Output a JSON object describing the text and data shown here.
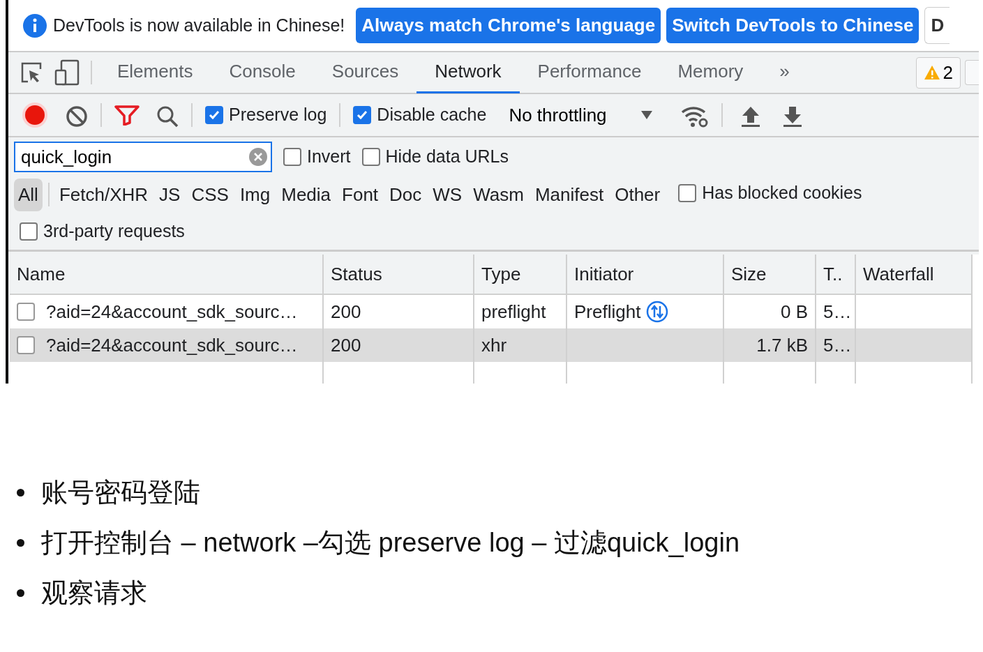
{
  "infobar": {
    "message": "DevTools is now available in Chinese!",
    "buttons": [
      "Always match Chrome's language",
      "Switch DevTools to Chinese",
      "D"
    ]
  },
  "panel_tabs": [
    {
      "label": "Elements",
      "selected": false
    },
    {
      "label": "Console",
      "selected": false
    },
    {
      "label": "Sources",
      "selected": false
    },
    {
      "label": "Network",
      "selected": true
    },
    {
      "label": "Performance",
      "selected": false
    },
    {
      "label": "Memory",
      "selected": false
    }
  ],
  "more_tabs": "»",
  "warnings": "2",
  "toolbar": {
    "recording": true,
    "preserve_log": {
      "label": "Preserve log",
      "checked": true
    },
    "disable_cache": {
      "label": "Disable cache",
      "checked": true
    },
    "throttling": "No throttling"
  },
  "filter": {
    "value": "quick_login",
    "invert": {
      "label": "Invert",
      "checked": false
    },
    "hide_data_urls": {
      "label": "Hide data URLs",
      "checked": false
    }
  },
  "type_filters": [
    {
      "label": "All",
      "selected": true
    },
    {
      "label": "Fetch/XHR",
      "selected": false
    },
    {
      "label": "JS",
      "selected": false
    },
    {
      "label": "CSS",
      "selected": false
    },
    {
      "label": "Img",
      "selected": false
    },
    {
      "label": "Media",
      "selected": false
    },
    {
      "label": "Font",
      "selected": false
    },
    {
      "label": "Doc",
      "selected": false
    },
    {
      "label": "WS",
      "selected": false
    },
    {
      "label": "Wasm",
      "selected": false
    },
    {
      "label": "Manifest",
      "selected": false
    },
    {
      "label": "Other",
      "selected": false
    }
  ],
  "has_blocked_cookies": {
    "label": "Has blocked cookies",
    "checked": false
  },
  "third_party": {
    "label": "3rd-party requests",
    "checked": false
  },
  "table": {
    "columns": [
      "Name",
      "Status",
      "Type",
      "Initiator",
      "Size",
      "T..",
      "Waterfall"
    ],
    "rows": [
      {
        "checked": false,
        "selected": false,
        "name": "?aid=24&account_sdk_sourc…",
        "status": "200",
        "type": "preflight",
        "initiator": "Preflight",
        "initiator_icon": true,
        "size": "0 B",
        "time": "5…"
      },
      {
        "checked": false,
        "selected": true,
        "name": "?aid=24&account_sdk_sourc…",
        "status": "200",
        "type": "xhr",
        "initiator": "",
        "initiator_icon": false,
        "size": "1.7 kB",
        "time": "5…"
      }
    ]
  },
  "bullets": [
    "账号密码登陆",
    "打开控制台 – network –勾选 preserve log – 过滤quick_login",
    "观察请求"
  ]
}
